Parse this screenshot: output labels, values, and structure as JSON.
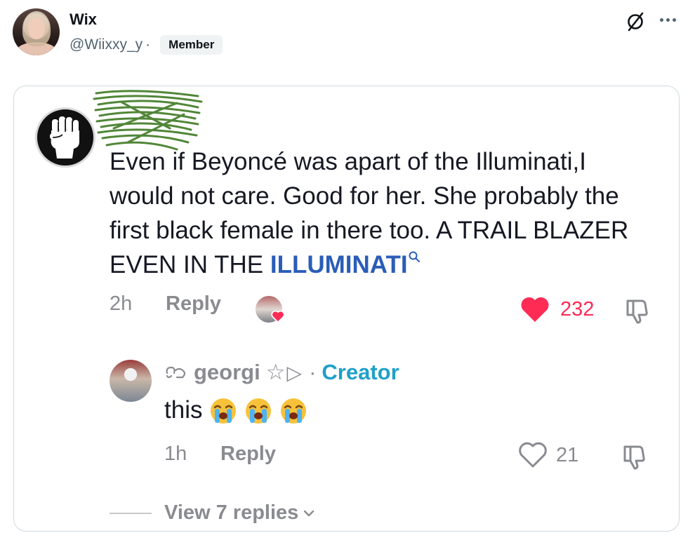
{
  "post": {
    "display_name": "Wix",
    "handle": "@Wiixxy_y",
    "separator": "·",
    "badge": "Member"
  },
  "icons": {
    "header_right": [
      "slash-circle-icon",
      "more-icon"
    ],
    "comment": [
      "raised-fist-icon",
      "search-icon",
      "heart-icon",
      "dislike-icon",
      "chevron-down-icon"
    ]
  },
  "comment": {
    "text_plain": "Even if Beyoncé was apart of the Illuminati,I would not care. Good for her. She probably the first black female in there too. A TRAIL BLAZER EVEN IN THE ",
    "text_highlight": "ILLUMINATI",
    "time": "2h",
    "reply_label": "Reply",
    "like_count": "232"
  },
  "reply": {
    "name": "georgi",
    "separator": "·",
    "role": "Creator",
    "text": "this",
    "emoji_count": 3,
    "time": "1h",
    "reply_label": "Reply",
    "like_count": "21"
  },
  "view_replies": "View 7 replies",
  "colors": {
    "like_red": "#fe2c55",
    "highlight_blue": "#2b5db8",
    "creator_blue": "#20a0c8",
    "muted_gray": "#8a8b91"
  }
}
